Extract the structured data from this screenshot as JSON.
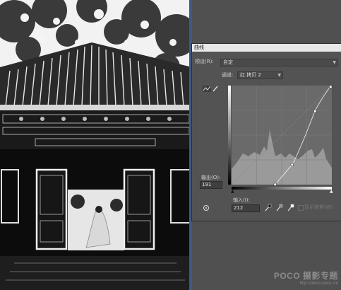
{
  "dialog": {
    "title": "曲线",
    "preset_label": "预设(R):",
    "preset_value": "自定",
    "channel_label": "通道:",
    "channel_value": "红 拷贝 2",
    "output_label": "输出(O):",
    "output_value": "191",
    "input_label": "输入(I):",
    "input_value": "212",
    "show_clipping_label": "显示修剪(W)"
  },
  "icons": {
    "curve_mode": "curve-point-icon",
    "pencil": "pencil-icon",
    "target_adjust": "hand-target-icon",
    "black_eyedropper": "black-eyedropper-icon",
    "gray_eyedropper": "gray-eyedropper-icon",
    "white_eyedropper": "white-eyedropper-icon"
  },
  "watermark": {
    "brand": "POCO 摄影专题",
    "url": "http://photo.poco.cn/"
  },
  "colors": {
    "panel_bg": "#535353",
    "graph_bg": "#6a6a6a",
    "histogram": "#9a9a9a"
  }
}
